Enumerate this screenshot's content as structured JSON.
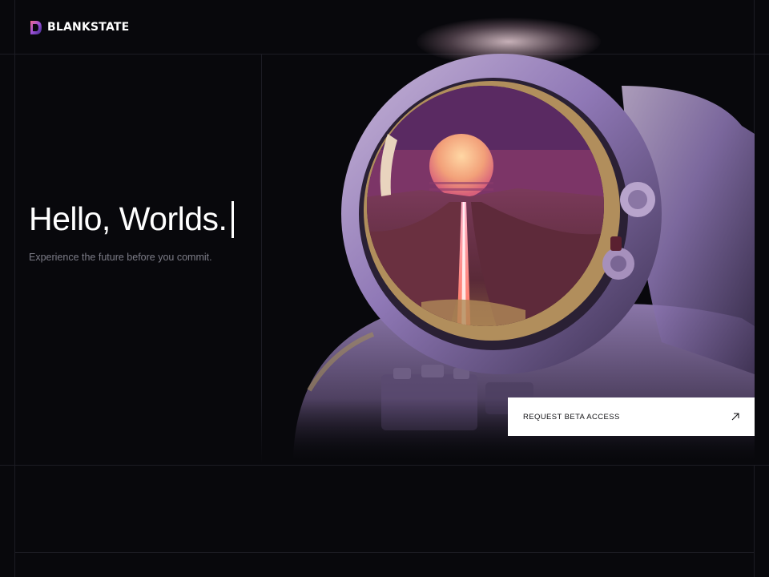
{
  "header": {
    "brand": "BLANKSTATE"
  },
  "hero": {
    "title": "Hello, Worlds.",
    "subtitle": "Experience the future before you commit."
  },
  "cta": {
    "label": "REQUEST BETA ACCESS",
    "icon": "arrow-up-right-icon"
  },
  "colors": {
    "background": "#08080c",
    "text": "#ffffff",
    "muted_text": "#7d7d88",
    "cta_background": "#ffffff",
    "cta_text": "#111114",
    "accent_purple": "#8f78b6",
    "accent_sunset": "#f2a079"
  }
}
